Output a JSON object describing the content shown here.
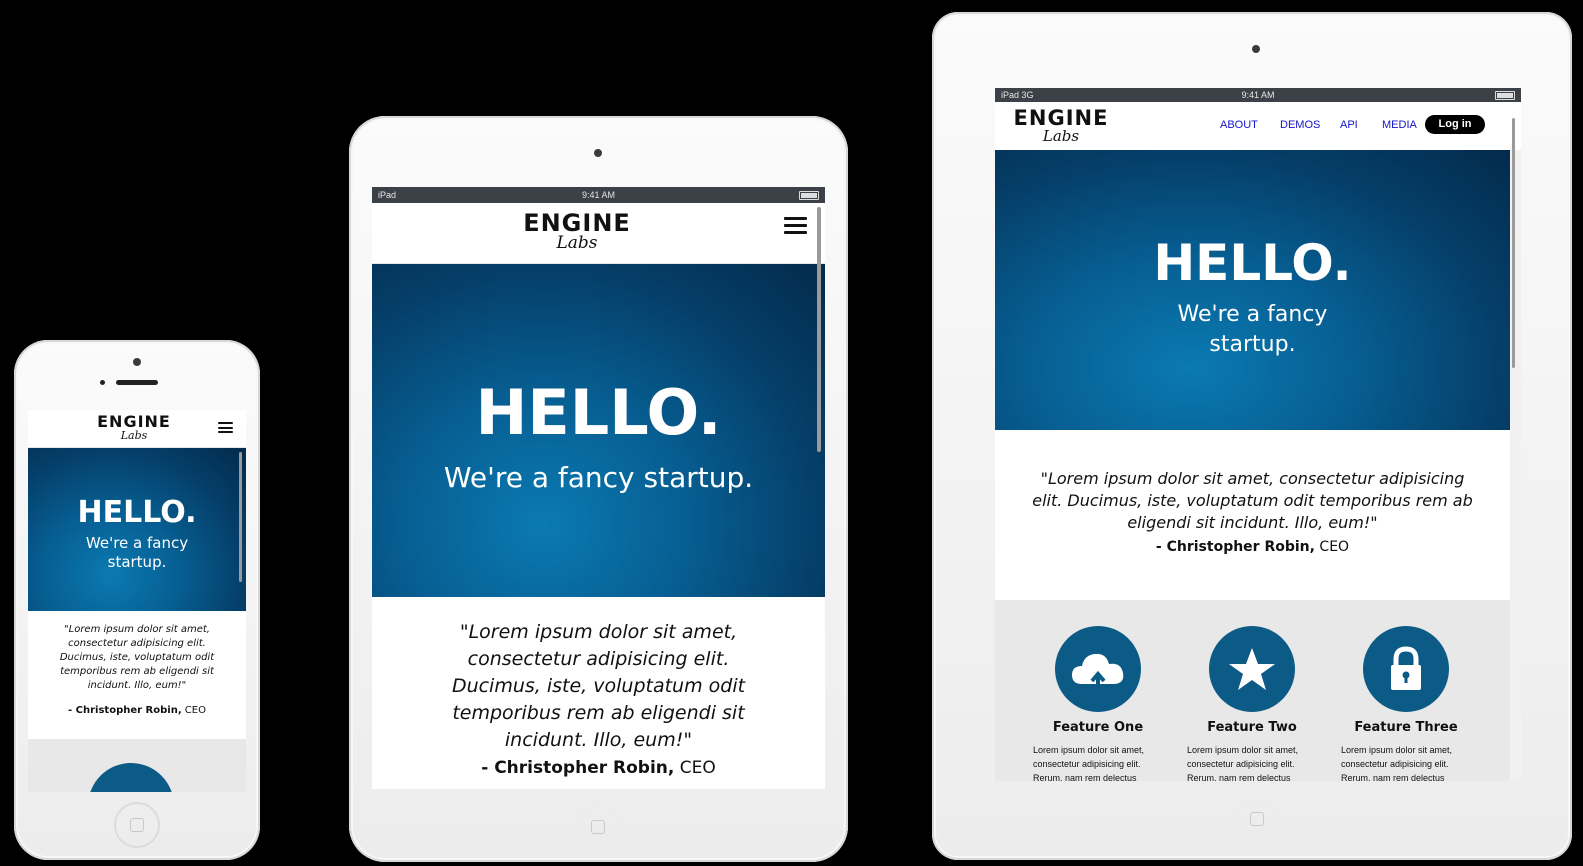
{
  "brand": {
    "logo_top": "ENGINE",
    "logo_sub": "Labs"
  },
  "status": {
    "carrier_mini": "iPad",
    "carrier_large": "iPad  3G",
    "time": "9:41 AM"
  },
  "hero": {
    "title": "HELLO.",
    "tagline": "We're a fancy startup."
  },
  "testimonial": {
    "quote": "\"Lorem ipsum dolor sit amet, consectetur adipisicing elit. Ducimus, iste, voluptatum odit temporibus rem ab eligendi sit incidunt. Illo, eum!\"",
    "author": "- Christopher Robin,",
    "role": " CEO"
  },
  "nav": {
    "items": [
      "ABOUT",
      "DEMOS",
      "API",
      "MEDIA"
    ],
    "login": "Log in"
  },
  "features": [
    {
      "title": "Feature One",
      "icon": "cloud-upload-icon",
      "desc": "Lorem ipsum dolor sit amet, consectetur adipisicing elit. Rerum, nam rem delectus"
    },
    {
      "title": "Feature Two",
      "icon": "star-icon",
      "desc": "Lorem ipsum dolor sit amet, consectetur adipisicing elit. Rerum, nam rem delectus"
    },
    {
      "title": "Feature Three",
      "icon": "lock-icon",
      "desc": "Lorem ipsum dolor sit amet, consectetur adipisicing elit. Rerum, nam rem delectus"
    }
  ],
  "colors": {
    "hero_blue": "#075f93",
    "feature_blue": "#0c5a86",
    "link_blue": "#1313c8"
  }
}
